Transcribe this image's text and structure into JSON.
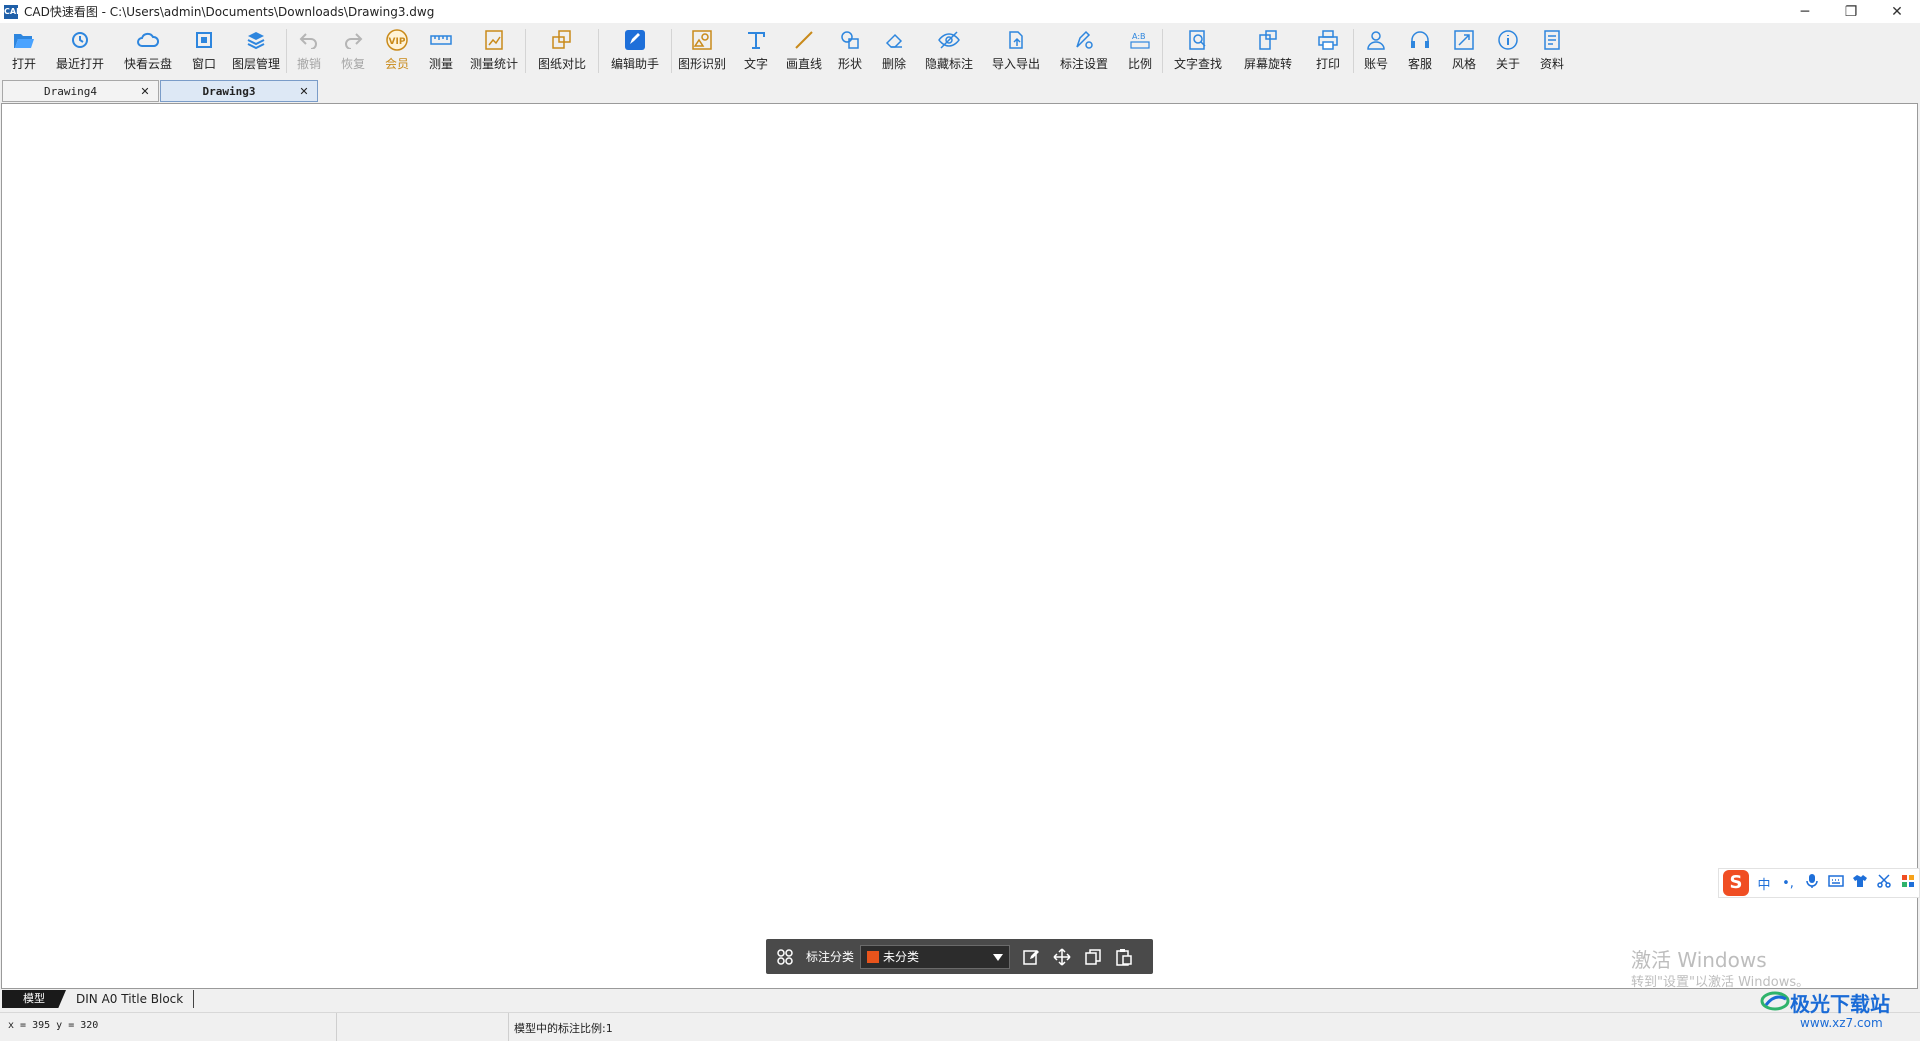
{
  "window": {
    "title": "CAD快速看图 - C:\\Users\\admin\\Documents\\Downloads\\Drawing3.dwg",
    "app_icon_text": "CAD",
    "minimize": "─",
    "restore": "❐",
    "close": "✕"
  },
  "toolbar": {
    "items": [
      {
        "label": "打开",
        "icon": "folder-open-icon"
      },
      {
        "label": "最近打开",
        "icon": "history-icon"
      },
      {
        "label": "快看云盘",
        "icon": "cloud-icon"
      },
      {
        "label": "窗口",
        "icon": "window-icon"
      },
      {
        "label": "图层管理",
        "icon": "layers-icon"
      },
      {
        "label": "撤销",
        "icon": "undo-icon",
        "disabled": true
      },
      {
        "label": "恢复",
        "icon": "redo-icon",
        "disabled": true
      },
      {
        "label": "会员",
        "icon": "vip-icon"
      },
      {
        "label": "测量",
        "icon": "ruler-icon"
      },
      {
        "label": "测量统计",
        "icon": "measure-stats-icon"
      },
      {
        "label": "图纸对比",
        "icon": "compare-icon"
      },
      {
        "label": "编辑助手",
        "icon": "edit-assistant-icon"
      },
      {
        "label": "图形识别",
        "icon": "shape-recognize-icon"
      },
      {
        "label": "文字",
        "icon": "text-icon"
      },
      {
        "label": "画直线",
        "icon": "line-icon"
      },
      {
        "label": "形状",
        "icon": "shape-icon"
      },
      {
        "label": "删除",
        "icon": "eraser-icon"
      },
      {
        "label": "隐藏标注",
        "icon": "eye-hide-icon"
      },
      {
        "label": "导入导出",
        "icon": "import-export-icon"
      },
      {
        "label": "标注设置",
        "icon": "annotation-settings-icon"
      },
      {
        "label": "比例",
        "icon": "scale-icon"
      },
      {
        "label": "文字查找",
        "icon": "text-search-icon"
      },
      {
        "label": "屏幕旋转",
        "icon": "rotate-screen-icon"
      },
      {
        "label": "打印",
        "icon": "print-icon"
      },
      {
        "label": "账号",
        "icon": "account-icon"
      },
      {
        "label": "客服",
        "icon": "headset-icon"
      },
      {
        "label": "风格",
        "icon": "style-icon"
      },
      {
        "label": "关于",
        "icon": "info-icon"
      },
      {
        "label": "资料",
        "icon": "docs-icon"
      }
    ]
  },
  "tabs": [
    {
      "label": "Drawing4",
      "close": "✕",
      "active": false
    },
    {
      "label": "Drawing3",
      "close": "✕",
      "active": true
    }
  ],
  "layout_tabs": {
    "model": "模型",
    "title_block": "DIN A0 Title Block"
  },
  "status": {
    "coords": "x = 395  y = 320",
    "scale": "模型中的标注比例:1"
  },
  "annotation_bar": {
    "label": "标注分类",
    "selected": "未分类",
    "swatch_color": "#e8541c"
  },
  "ime": {
    "logo": "S",
    "mode": "中",
    "punct": "•,"
  },
  "watermark": {
    "line1": "激活 Windows",
    "line2": "转到\"设置\"以激活 Windows。"
  },
  "site": {
    "name": "极光下载站",
    "url": "www.xz7.com"
  }
}
